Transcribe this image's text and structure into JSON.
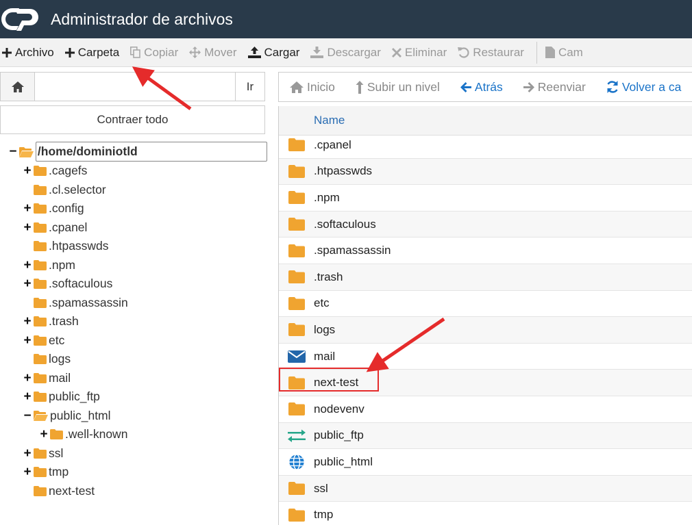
{
  "app": {
    "title": "Administrador de archivos"
  },
  "toolbar": {
    "items": [
      {
        "label": "Archivo",
        "icon": "plus-icon",
        "enabled": true
      },
      {
        "label": "Carpeta",
        "icon": "plus-icon",
        "enabled": true
      },
      {
        "label": "Copiar",
        "icon": "copy-icon",
        "enabled": false
      },
      {
        "label": "Mover",
        "icon": "move-icon",
        "enabled": false
      },
      {
        "label": "Cargar",
        "icon": "upload-icon",
        "enabled": true
      },
      {
        "label": "Descargar",
        "icon": "download-icon",
        "enabled": false
      },
      {
        "label": "Eliminar",
        "icon": "close-icon",
        "enabled": false
      },
      {
        "label": "Restaurar",
        "icon": "undo-icon",
        "enabled": false
      },
      {
        "label": "Cam",
        "icon": "file-icon",
        "enabled": false
      }
    ]
  },
  "pathbar": {
    "value": "",
    "go_label": "Ir"
  },
  "sidebar": {
    "collapse_label": "Contraer todo",
    "root": "/home/dominiotld",
    "items": [
      {
        "label": ".cagefs",
        "toggle": "+",
        "indent": 1
      },
      {
        "label": ".cl.selector",
        "toggle": "",
        "indent": 1
      },
      {
        "label": ".config",
        "toggle": "+",
        "indent": 1
      },
      {
        "label": ".cpanel",
        "toggle": "+",
        "indent": 1
      },
      {
        "label": ".htpasswds",
        "toggle": "",
        "indent": 1
      },
      {
        "label": ".npm",
        "toggle": "+",
        "indent": 1
      },
      {
        "label": ".softaculous",
        "toggle": "+",
        "indent": 1
      },
      {
        "label": ".spamassassin",
        "toggle": "",
        "indent": 1
      },
      {
        "label": ".trash",
        "toggle": "+",
        "indent": 1
      },
      {
        "label": "etc",
        "toggle": "+",
        "indent": 1
      },
      {
        "label": "logs",
        "toggle": "",
        "indent": 1
      },
      {
        "label": "mail",
        "toggle": "+",
        "indent": 1
      },
      {
        "label": "public_ftp",
        "toggle": "+",
        "indent": 1
      },
      {
        "label": "public_html",
        "toggle": "−",
        "indent": 1,
        "open": true
      },
      {
        "label": ".well-known",
        "toggle": "+",
        "indent": 2
      },
      {
        "label": "ssl",
        "toggle": "+",
        "indent": 1
      },
      {
        "label": "tmp",
        "toggle": "+",
        "indent": 1
      },
      {
        "label": "next-test",
        "toggle": "",
        "indent": 1
      }
    ]
  },
  "nav": {
    "items": [
      {
        "label": "Inicio",
        "icon": "home-icon",
        "color": "grey"
      },
      {
        "label": "Subir un nivel",
        "icon": "level-up-icon",
        "color": "grey"
      },
      {
        "label": "Atrás",
        "icon": "arrow-left-icon",
        "color": "blue"
      },
      {
        "label": "Reenviar",
        "icon": "arrow-right-icon",
        "color": "grey"
      },
      {
        "label": "Volver a ca",
        "icon": "refresh-icon",
        "color": "blue"
      }
    ]
  },
  "list": {
    "column_name": "Name",
    "rows": [
      {
        "name": ".cpanel",
        "icon": "folder"
      },
      {
        "name": ".htpasswds",
        "icon": "folder"
      },
      {
        "name": ".npm",
        "icon": "folder"
      },
      {
        "name": ".softaculous",
        "icon": "folder"
      },
      {
        "name": ".spamassassin",
        "icon": "folder"
      },
      {
        "name": ".trash",
        "icon": "folder"
      },
      {
        "name": "etc",
        "icon": "folder"
      },
      {
        "name": "logs",
        "icon": "folder"
      },
      {
        "name": "mail",
        "icon": "mail"
      },
      {
        "name": "next-test",
        "icon": "folder"
      },
      {
        "name": "nodevenv",
        "icon": "folder"
      },
      {
        "name": "public_ftp",
        "icon": "ftp"
      },
      {
        "name": "public_html",
        "icon": "globe"
      },
      {
        "name": "ssl",
        "icon": "folder"
      },
      {
        "name": "tmp",
        "icon": "folder"
      }
    ]
  },
  "colors": {
    "titlebar": "#293a4a",
    "folder": "#f0a430",
    "link": "#1a73c8",
    "annotation": "#e52b2b"
  }
}
